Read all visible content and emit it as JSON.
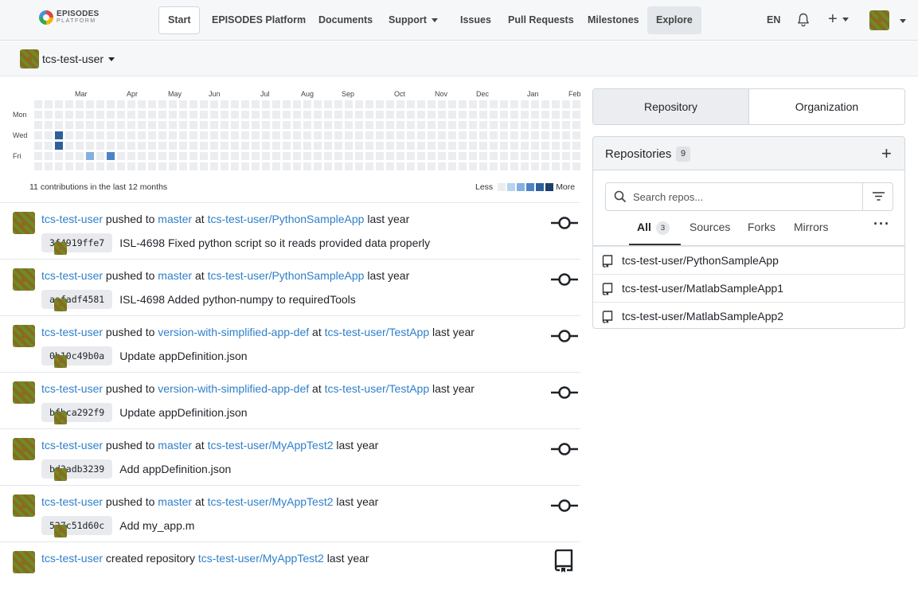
{
  "nav": {
    "logo_line1": "EPISODES",
    "logo_line2": "PLATFORM",
    "items": [
      {
        "label": "Start"
      },
      {
        "label": "EPISODES Platform"
      },
      {
        "label": "Documents"
      },
      {
        "label": "Support"
      },
      {
        "label": "Issues"
      },
      {
        "label": "Pull Requests"
      },
      {
        "label": "Milestones"
      },
      {
        "label": "Explore"
      }
    ],
    "lang": "EN",
    "plus": "+"
  },
  "context_user": "tcs-test-user",
  "heatmap": {
    "months": [
      "Mar",
      "Apr",
      "May",
      "Jun",
      "Jul",
      "Aug",
      "Sep",
      "Oct",
      "Nov",
      "Dec",
      "Jan",
      "Feb"
    ],
    "days": [
      "Mon",
      "Wed",
      "Fri"
    ],
    "total_text": "11 contributions in the last 12 months",
    "legend_less": "Less",
    "legend_more": "More",
    "colors": [
      "#ebedf0",
      "#b7d3ef",
      "#84b0e0",
      "#4d83c6",
      "#2d5f9a",
      "#1b3f6b"
    ]
  },
  "feed": [
    {
      "user": "tcs-test-user",
      "action": "pushed to",
      "branch": "master",
      "at": "at",
      "repo": "tcs-test-user/PythonSampleApp",
      "when": "last year",
      "sha": "3f4919ffe7",
      "message": "ISL-4698 Fixed python script so it reads provided data properly"
    },
    {
      "user": "tcs-test-user",
      "action": "pushed to",
      "branch": "master",
      "at": "at",
      "repo": "tcs-test-user/PythonSampleApp",
      "when": "last year",
      "sha": "aafadf4581",
      "message": "ISL-4698 Added python-numpy to requiredTools"
    },
    {
      "user": "tcs-test-user",
      "action": "pushed to",
      "branch": "version-with-simplified-app-def",
      "at": "at",
      "repo": "tcs-test-user/TestApp",
      "when": "last year",
      "sha": "0b10c49b0a",
      "message": "Update appDefinition.json"
    },
    {
      "user": "tcs-test-user",
      "action": "pushed to",
      "branch": "version-with-simplified-app-def",
      "at": "at",
      "repo": "tcs-test-user/TestApp",
      "when": "last year",
      "sha": "bfbca292f9",
      "message": "Update appDefinition.json"
    },
    {
      "user": "tcs-test-user",
      "action": "pushed to",
      "branch": "master",
      "at": "at",
      "repo": "tcs-test-user/MyAppTest2",
      "when": "last year",
      "sha": "bd3adb3239",
      "message": "Add appDefinition.json"
    },
    {
      "user": "tcs-test-user",
      "action": "pushed to",
      "branch": "master",
      "at": "at",
      "repo": "tcs-test-user/MyAppTest2",
      "when": "last year",
      "sha": "527c51d60c",
      "message": "Add my_app.m"
    },
    {
      "user": "tcs-test-user",
      "action": "created repository",
      "repo": "tcs-test-user/MyAppTest2",
      "when": "last year"
    }
  ],
  "right": {
    "tabs": [
      "Repository",
      "Organization"
    ],
    "repos_title": "Repositories",
    "repos_count": "9",
    "add": "+",
    "search_placeholder": "Search repos...",
    "filter_tabs": [
      "All",
      "Sources",
      "Forks",
      "Mirrors"
    ],
    "all_count": "3",
    "more": "···",
    "repos": [
      "tcs-test-user/PythonSampleApp",
      "tcs-test-user/MatlabSampleApp1",
      "tcs-test-user/MatlabSampleApp2"
    ]
  }
}
